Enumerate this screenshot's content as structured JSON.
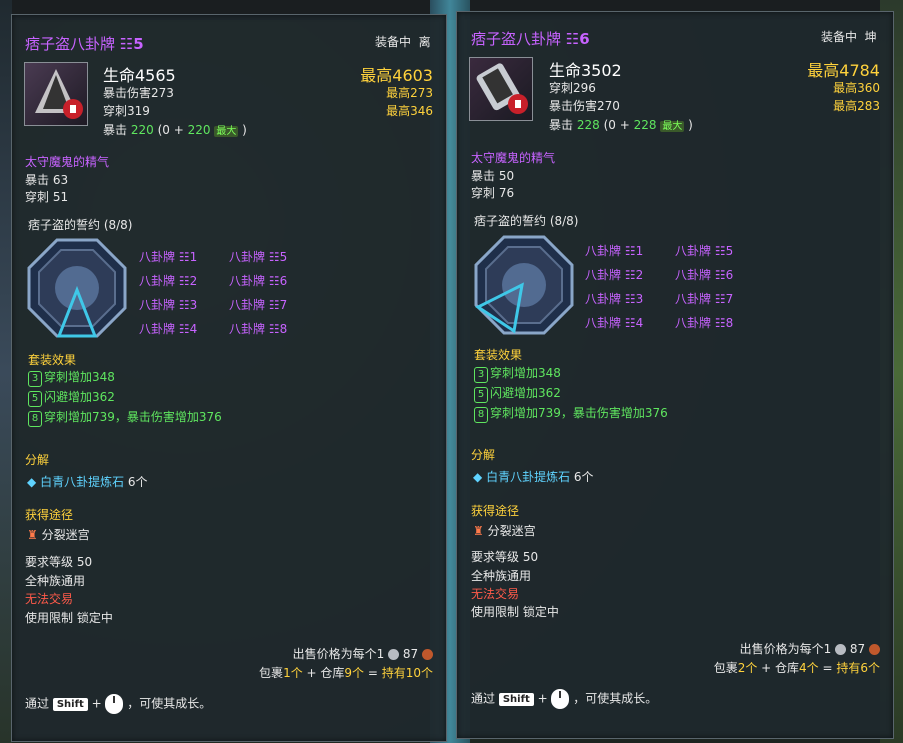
{
  "left": {
    "title": "痞子盗八卦牌",
    "title_num": "☷5",
    "equip_status": "装备中",
    "equip_slot": "离",
    "hp_label": "生命4565",
    "max_label": "最高4603",
    "stat1": "暴击伤害273",
    "stat1_max": "最高273",
    "stat2": "穿刺319",
    "stat2_max": "最高346",
    "crit_label": "暴击",
    "crit_value": "220",
    "crit_open": "(0 +",
    "crit_plus": "220",
    "crit_max_badge": "最大",
    "crit_close": ")",
    "bonus_title": "太守魔鬼的精气",
    "bonus1": "暴击 63",
    "bonus2": "穿刺 51",
    "set_title": "痞子盗的誓约 (8/8)",
    "set_items": [
      "八卦牌 ☷1",
      "八卦牌 ☷2",
      "八卦牌 ☷3",
      "八卦牌 ☷4",
      "八卦牌 ☷5",
      "八卦牌 ☷6",
      "八卦牌 ☷7",
      "八卦牌 ☷8"
    ],
    "set_effect_title": "套装效果",
    "effects": [
      {
        "n": "3",
        "text": "穿刺增加348"
      },
      {
        "n": "5",
        "text": "闪避增加362"
      },
      {
        "n": "8",
        "text": "穿刺增加739，暴击伤害增加376"
      }
    ],
    "decompose_title": "分解",
    "decompose_item": "白青八卦提炼石",
    "decompose_qty": "6个",
    "source_title": "获得途径",
    "source_item": "分裂迷宫",
    "req_level": "要求等级 50",
    "race": "全种族通用",
    "trade": "无法交易",
    "limit": "使用限制 锁定中",
    "price_prefix": "出售价格为每个1",
    "price_copper": "87",
    "bag_prefix": "包裹",
    "bag_qty": "1个",
    "plus1": " + 仓库",
    "warehouse_qty": "9个",
    "equals": " = ",
    "total": "持有10个",
    "hint_prefix": "通过",
    "hint_key": "Shift",
    "hint_plus": "+",
    "hint_suffix": "，可使其成长。"
  },
  "right": {
    "title": "痞子盗八卦牌",
    "title_num": "☷6",
    "equip_status": "装备中",
    "equip_slot": "坤",
    "hp_label": "生命3502",
    "max_label": "最高4784",
    "stat1": "穿刺296",
    "stat1_max": "最高360",
    "stat2": "暴击伤害270",
    "stat2_max": "最高283",
    "crit_label": "暴击",
    "crit_value": "228",
    "crit_open": "(0 +",
    "crit_plus": "228",
    "crit_max_badge": "最大",
    "crit_close": ")",
    "bonus_title": "太守魔鬼的精气",
    "bonus1": "暴击 50",
    "bonus2": "穿刺 76",
    "set_title": "痞子盗的誓约 (8/8)",
    "set_items": [
      "八卦牌 ☷1",
      "八卦牌 ☷2",
      "八卦牌 ☷3",
      "八卦牌 ☷4",
      "八卦牌 ☷5",
      "八卦牌 ☷6",
      "八卦牌 ☷7",
      "八卦牌 ☷8"
    ],
    "set_effect_title": "套装效果",
    "effects": [
      {
        "n": "3",
        "text": "穿刺增加348"
      },
      {
        "n": "5",
        "text": "闪避增加362"
      },
      {
        "n": "8",
        "text": "穿刺增加739，暴击伤害增加376"
      }
    ],
    "decompose_title": "分解",
    "decompose_item": "白青八卦提炼石",
    "decompose_qty": "6个",
    "source_title": "获得途径",
    "source_item": "分裂迷宫",
    "req_level": "要求等级 50",
    "race": "全种族通用",
    "trade": "无法交易",
    "limit": "使用限制 锁定中",
    "price_prefix": "出售价格为每个1",
    "price_copper": "87",
    "bag_prefix": "包裹",
    "bag_qty": "2个",
    "plus1": " + 仓库",
    "warehouse_qty": "4个",
    "equals": " = ",
    "total": "持有6个",
    "hint_prefix": "通过",
    "hint_key": "Shift",
    "hint_plus": "+",
    "hint_suffix": "，可使其成长。"
  }
}
